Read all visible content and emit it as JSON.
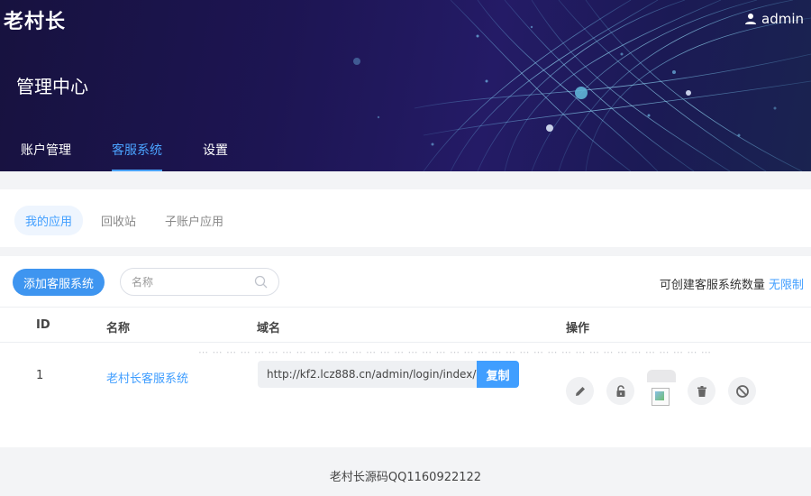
{
  "header": {
    "logo": "老村长",
    "user": "admin",
    "title": "管理中心",
    "nav": [
      {
        "label": "账户管理",
        "active": false
      },
      {
        "label": "客服系统",
        "active": true
      },
      {
        "label": "设置",
        "active": false
      }
    ]
  },
  "tabs": [
    {
      "label": "我的应用",
      "active": true
    },
    {
      "label": "回收站",
      "active": false
    },
    {
      "label": "子账户应用",
      "active": false
    }
  ],
  "toolbar": {
    "add_label": "添加客服系统",
    "search_placeholder": "名称",
    "quota_label": "可创建客服系统数量",
    "quota_value": "无限制"
  },
  "table": {
    "columns": [
      "ID",
      "名称",
      "域名",
      "操作"
    ],
    "rows": [
      {
        "id": "1",
        "name": "老村长客服系统",
        "domain": "http://kf2.lcz888.cn/admin/login/index/",
        "copy_label": "复制"
      }
    ]
  },
  "actions": [
    "edit-icon",
    "unlock-icon",
    "broken-image-icon",
    "trash-icon",
    "ban-icon"
  ],
  "colors": {
    "accent": "#409eff",
    "banner_dark": "#1d1553"
  },
  "footer": "老村长源码QQ1160922122"
}
